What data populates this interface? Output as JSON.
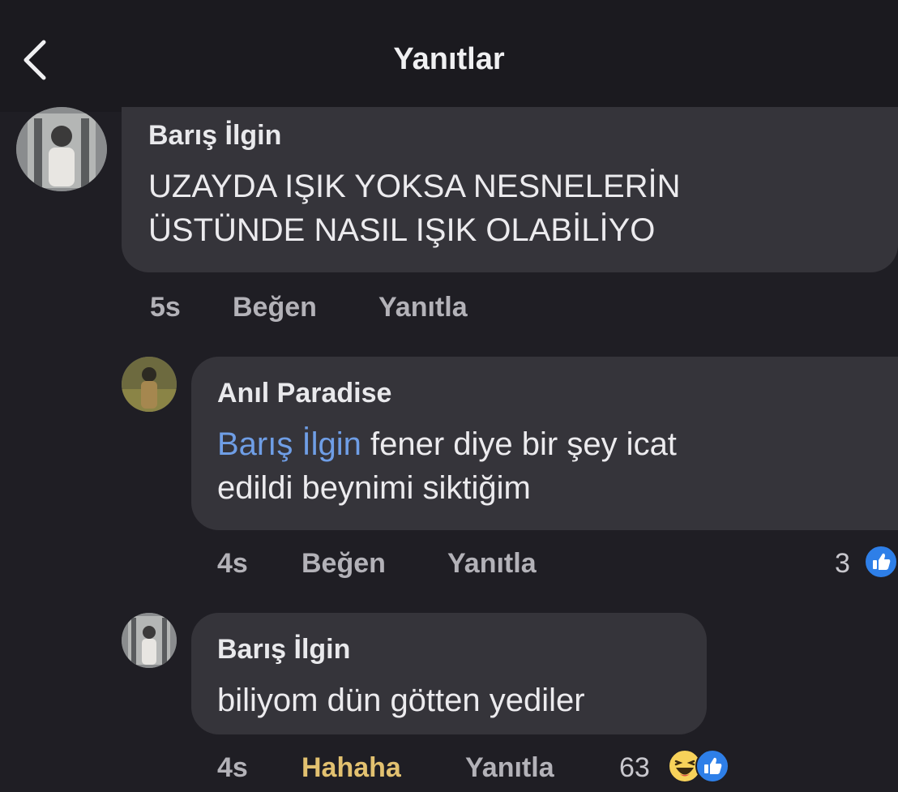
{
  "header": {
    "title": "Yanıtlar",
    "back_icon": "chevron-left-icon"
  },
  "comments": [
    {
      "author": "Barış İlgin",
      "lines": [
        "UZAYDA IŞIK YOKSA NESNELERİN",
        "ÜSTÜNDE NASIL IŞIK OLABİLİYO"
      ],
      "time": "5s",
      "like_label": "Beğen",
      "reply_label": "Yanıtla"
    },
    {
      "author": "Anıl Paradise",
      "mention": "Barış İlgin",
      "line1_rest": " fener diye bir şey icat",
      "line2": "edildi beynimi siktiğim",
      "time": "4s",
      "like_label": "Beğen",
      "reply_label": "Yanıtla",
      "reaction_count": "3",
      "reaction_icons": [
        "like-icon"
      ]
    },
    {
      "author": "Barış İlgin",
      "text": "biliyom dün götten yediler",
      "time": "4s",
      "reaction_label": "Hahaha",
      "reply_label": "Yanıtla",
      "reaction_count": "63",
      "reaction_icons": [
        "haha-icon",
        "like-icon"
      ]
    }
  ],
  "colors": {
    "background": "#1f1e24",
    "bubble": "#35343a",
    "mention": "#6f9ee6",
    "haha_reaction": "#e2c170",
    "like_blue": "#2e7fe8"
  }
}
